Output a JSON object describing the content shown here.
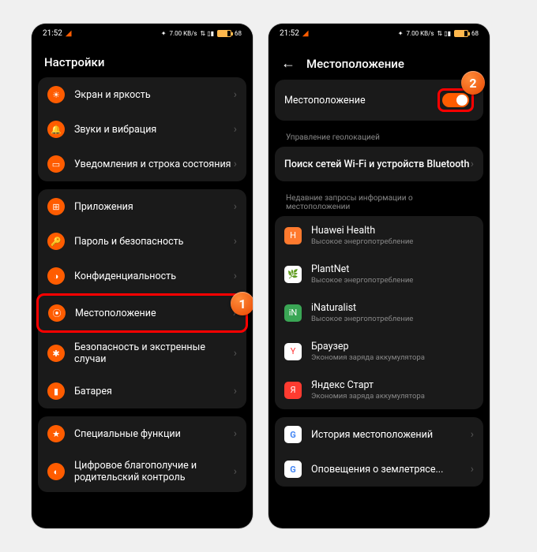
{
  "status": {
    "time": "21:52",
    "net": "7.00 KB/s",
    "battery": "68"
  },
  "left": {
    "title": "Настройки",
    "group1": [
      {
        "icon": "sun-icon",
        "label": "Экран и яркость"
      },
      {
        "icon": "bell-icon",
        "label": "Звуки и вибрация"
      },
      {
        "icon": "notification-icon",
        "label": "Уведомления и строка состояния"
      }
    ],
    "group2": [
      {
        "icon": "apps-icon",
        "label": "Приложения"
      },
      {
        "icon": "key-icon",
        "label": "Пароль и безопасность"
      },
      {
        "icon": "privacy-icon",
        "label": "Конфиденциальность"
      },
      {
        "icon": "location-icon",
        "label": "Местоположение"
      },
      {
        "icon": "security-icon",
        "label": "Безопасность и экстренные случаи"
      },
      {
        "icon": "battery-icon",
        "label": "Батарея"
      }
    ],
    "group3": [
      {
        "icon": "special-icon",
        "label": "Специальные функции"
      },
      {
        "icon": "wellbeing-icon",
        "label": "Цифровое благополучие и родительский контроль"
      }
    ]
  },
  "right": {
    "title": "Местоположение",
    "toggle_row": {
      "label": "Местоположение"
    },
    "section1_label": "Управление геолокацией",
    "wifi_bt": "Поиск сетей Wi-Fi и устройств Bluetooth",
    "section2_label": "Недавние запросы информации о местоположении",
    "apps": [
      {
        "name": "Huawei Health",
        "sub": "Высокое энергопотребление",
        "color": "#ff7a2e"
      },
      {
        "name": "PlantNet",
        "sub": "Высокое энергопотребление",
        "color": "#2aa86f"
      },
      {
        "name": "iNaturalist",
        "sub": "Высокое энергопотребление",
        "color": "#3aa655"
      },
      {
        "name": "Браузер",
        "sub": "Экономия заряда аккумулятора",
        "color": "#fff"
      },
      {
        "name": "Яндекс Старт",
        "sub": "Экономия заряда аккумулятора",
        "color": "#ff3b30"
      }
    ],
    "group_last": [
      {
        "label": "История местоположений",
        "google": true
      },
      {
        "label": "Оповещения о землетрясе...",
        "google": true
      }
    ]
  },
  "callouts": {
    "one": "1",
    "two": "2"
  }
}
